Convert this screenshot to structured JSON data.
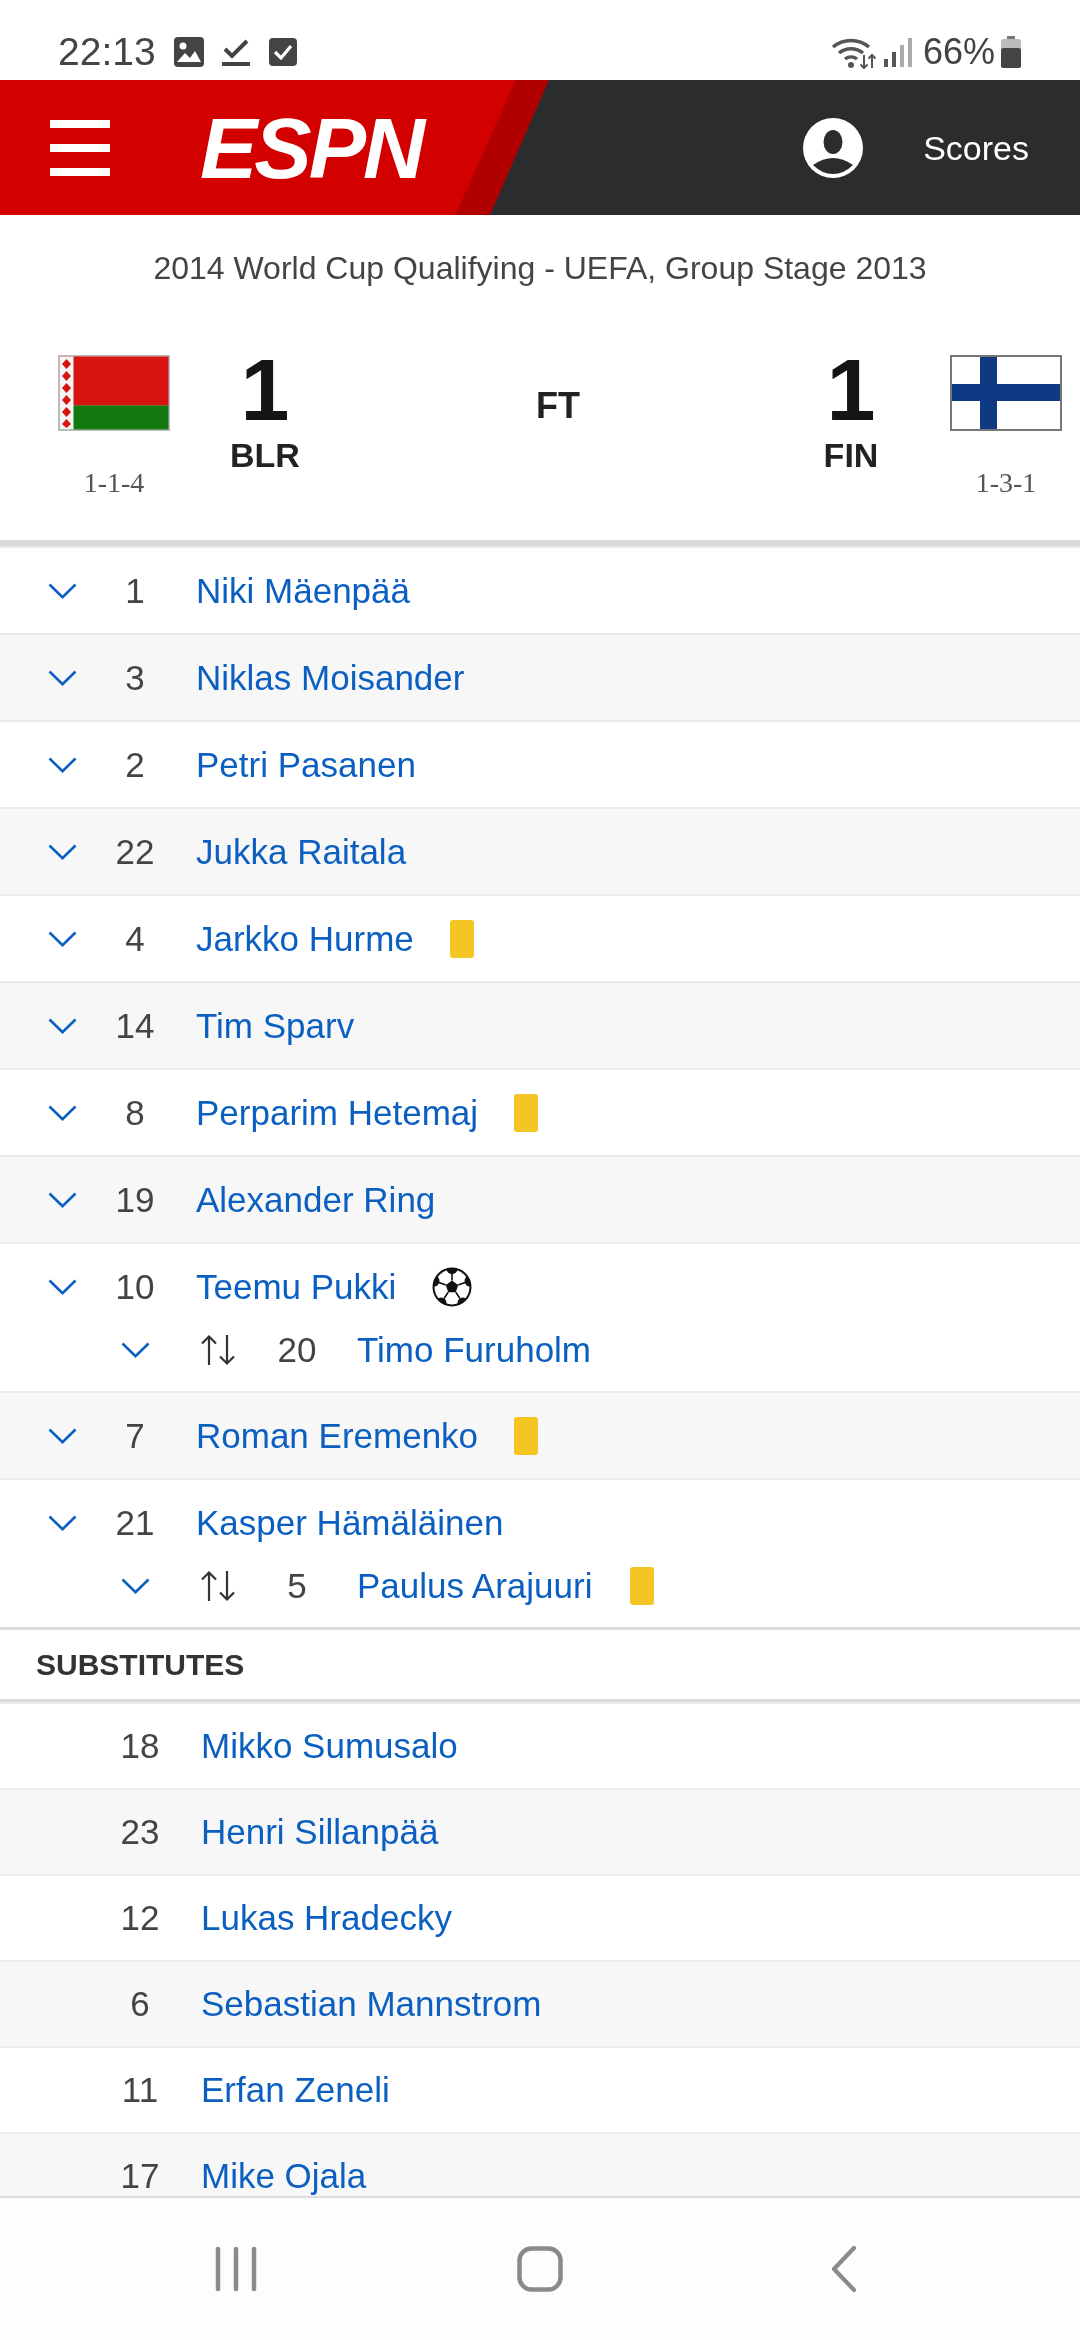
{
  "status_bar": {
    "time": "22:13",
    "battery": "66%"
  },
  "header": {
    "logo": "ESPN",
    "link": "Scores"
  },
  "match": {
    "competition": "2014 World Cup Qualifying - UEFA, Group Stage 2013",
    "status": "FT",
    "home": {
      "score": "1",
      "abbr": "BLR",
      "record": "1-1-4"
    },
    "away": {
      "score": "1",
      "abbr": "FIN",
      "record": "1-3-1"
    }
  },
  "lineup": [
    {
      "number": "1",
      "name": "Niki Mäenpää",
      "expanded": false
    },
    {
      "number": "3",
      "name": "Niklas Moisander",
      "expanded": false
    },
    {
      "number": "2",
      "name": "Petri Pasanen",
      "expanded": false
    },
    {
      "number": "22",
      "name": "Jukka Raitala",
      "expanded": false
    },
    {
      "number": "4",
      "name": "Jarkko Hurme",
      "expanded": false,
      "events": [
        {
          "kind": "yellow_card"
        }
      ]
    },
    {
      "number": "14",
      "name": "Tim Sparv",
      "expanded": false
    },
    {
      "number": "8",
      "name": "Perparim Hetemaj",
      "expanded": false,
      "events": [
        {
          "kind": "yellow_card"
        }
      ]
    },
    {
      "number": "19",
      "name": "Alexander Ring",
      "expanded": false
    },
    {
      "number": "10",
      "name": "Teemu Pukki",
      "expanded": false,
      "events": [
        {
          "kind": "goal"
        }
      ],
      "substitute": {
        "number": "20",
        "name": "Timo Furuholm",
        "expanded": false
      }
    },
    {
      "number": "7",
      "name": "Roman Eremenko",
      "expanded": false,
      "events": [
        {
          "kind": "yellow_card"
        }
      ]
    },
    {
      "number": "21",
      "name": "Kasper Hämäläinen",
      "expanded": false,
      "substitute": {
        "number": "5",
        "name": "Paulus Arajuuri",
        "expanded": false,
        "events": [
          {
            "kind": "yellow_card"
          }
        ]
      }
    }
  ],
  "substitutes": {
    "title": "SUBSTITUTES",
    "players": [
      {
        "number": "18",
        "name": "Mikko Sumusalo"
      },
      {
        "number": "23",
        "name": "Henri Sillanpää"
      },
      {
        "number": "12",
        "name": "Lukas Hradecky"
      },
      {
        "number": "6",
        "name": "Sebastian Mannstrom"
      },
      {
        "number": "11",
        "name": "Erfan Zeneli"
      },
      {
        "number": "17",
        "name": "Mike Ojala"
      }
    ]
  }
}
